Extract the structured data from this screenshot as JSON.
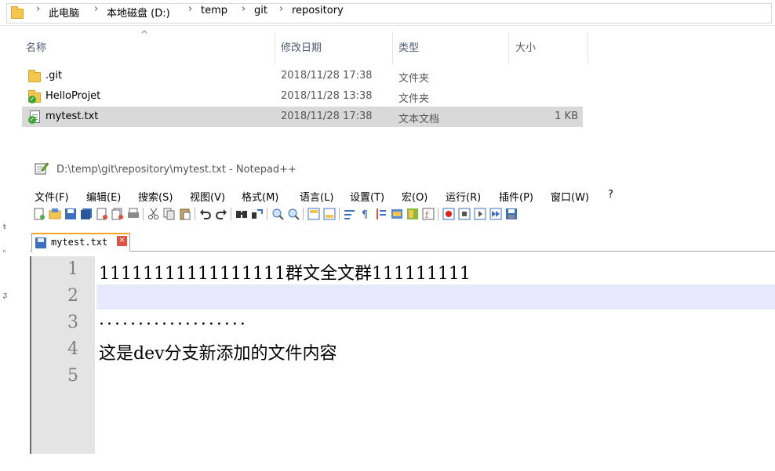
{
  "explorer": {
    "breadcrumb": [
      "此电脑",
      "本地磁盘 (D:)",
      "temp",
      "git",
      "repository"
    ],
    "separator": "›",
    "columns": {
      "name": "名称",
      "modified": "修改日期",
      "type": "类型",
      "size": "大小"
    },
    "files": [
      {
        "name": ".git",
        "modified": "2018/11/28 17:38",
        "type": "文件夹",
        "size": "",
        "icon": "folder-icon"
      },
      {
        "name": "HelloProjet",
        "modified": "2018/11/28 13:38",
        "type": "文件夹",
        "size": "",
        "icon": "git-folder-icon"
      },
      {
        "name": "mytest.txt",
        "modified": "2018/11/28 17:38",
        "type": "文本文档",
        "size": "1 KB",
        "icon": "git-text-file-icon"
      }
    ],
    "left_pane_glyphs": [
      "ŧ",
      "ₙ",
      "ᶚ"
    ]
  },
  "notepad": {
    "title": "D:\\temp\\git\\repository\\mytest.txt - Notepad++",
    "menu": [
      "文件(F)",
      "编辑(E)",
      "搜索(S)",
      "视图(V)",
      "格式(M)",
      "语言(L)",
      "设置(T)",
      "宏(O)",
      "运行(R)",
      "插件(P)",
      "窗口(W)",
      "?"
    ],
    "tab": {
      "name": "mytest.txt",
      "close": "×"
    },
    "lines": [
      {
        "num": "1",
        "text": "11111111111111111群文全文群111111111"
      },
      {
        "num": "2",
        "text": ""
      },
      {
        "num": "3",
        "text": "..................."
      },
      {
        "num": "4",
        "text": "这是dev分支新添加的文件内容"
      },
      {
        "num": "5",
        "text": ""
      }
    ],
    "current_line": 2,
    "colors": {
      "current_line_bg": "#e8e8ff",
      "gutter_bg": "#e4e4e4",
      "tab_accent": "#f6a623"
    }
  }
}
